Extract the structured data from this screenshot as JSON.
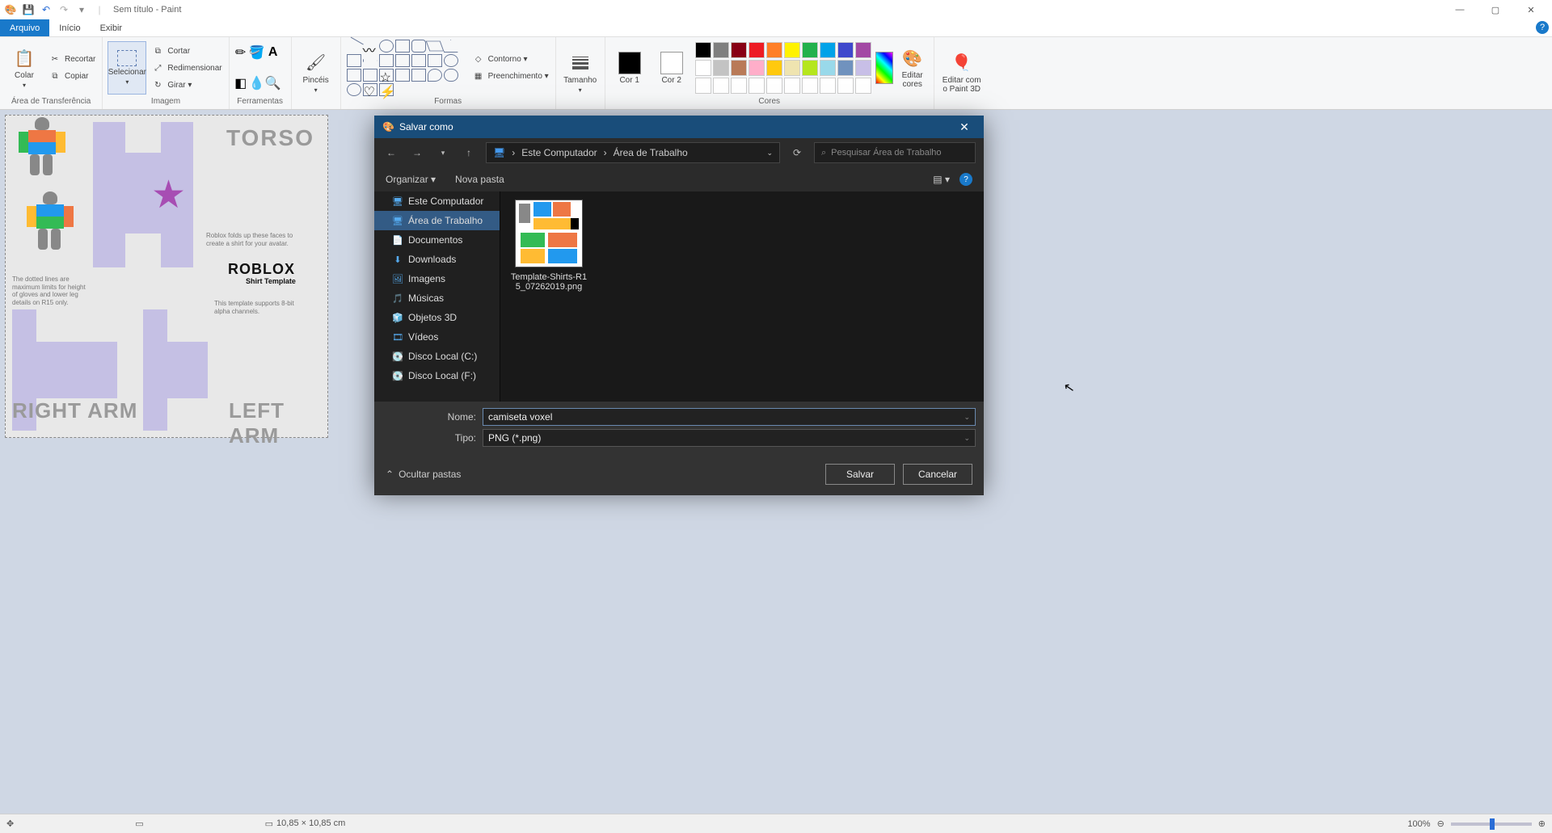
{
  "title": "Sem título - Paint",
  "tabs": {
    "file": "Arquivo",
    "home": "Início",
    "view": "Exibir"
  },
  "ribbon": {
    "clipboard": {
      "paste": "Colar",
      "cut": "Recortar",
      "copy": "Copiar",
      "label": "Área de Transferência"
    },
    "image": {
      "select": "Selecionar",
      "crop": "Cortar",
      "resize": "Redimensionar",
      "rotate": "Girar ▾",
      "label": "Imagem"
    },
    "tools": {
      "label": "Ferramentas"
    },
    "brushes": {
      "brushes": "Pincéis",
      "label": ""
    },
    "shapes": {
      "outline": "Contorno ▾",
      "fill": "Preenchimento ▾",
      "label": "Formas"
    },
    "size": {
      "label": "Tamanho"
    },
    "colors": {
      "c1": "Cor 1",
      "c2": "Cor 2",
      "edit": "Editar cores",
      "label": "Cores",
      "c1v": "#000000",
      "c2v": "#ffffff",
      "palette": [
        "#000000",
        "#7f7f7f",
        "#880015",
        "#ed1c24",
        "#ff7f27",
        "#fff200",
        "#22b14c",
        "#00a2e8",
        "#3f48cc",
        "#a349a4",
        "#ffffff",
        "#c3c3c3",
        "#b97a57",
        "#ffaec9",
        "#ffc90e",
        "#efe4b0",
        "#b5e61d",
        "#99d9ea",
        "#7092be",
        "#c8bfe7",
        "#ffffff",
        "#ffffff",
        "#ffffff",
        "#ffffff",
        "#ffffff",
        "#ffffff",
        "#ffffff",
        "#ffffff",
        "#ffffff",
        "#ffffff"
      ]
    },
    "paint3d": {
      "label": "Editar com o Paint 3D"
    }
  },
  "canvas": {
    "torso": "TORSO",
    "right_arm": "RIGHT ARM",
    "left_arm": "LEFT ARM",
    "roblox": "ROBLOX",
    "roblox_sub": "Shirt Template",
    "note1": "Roblox folds up these faces to create a shirt for your avatar.",
    "note2": "The dotted lines are maximum limits for height of gloves and lower leg details on R15 only.",
    "note3": "This template supports 8-bit alpha channels."
  },
  "status": {
    "dims": "10,85 × 10,85 cm",
    "zoom": "100%"
  },
  "dialog": {
    "title": "Salvar como",
    "breadcrumb": [
      "Este Computador",
      "Área de Trabalho"
    ],
    "search_placeholder": "Pesquisar Área de Trabalho",
    "organize": "Organizar ▾",
    "newfolder": "Nova pasta",
    "tree": [
      "Este Computador",
      "Área de Trabalho",
      "Documentos",
      "Downloads",
      "Imagens",
      "Músicas",
      "Objetos 3D",
      "Vídeos",
      "Disco Local (C:)",
      "Disco Local (F:)"
    ],
    "tree_selected": 1,
    "file": {
      "name": "Template-Shirts-R15_07262019.png"
    },
    "name_label": "Nome:",
    "name_value": "camiseta voxel",
    "type_label": "Tipo:",
    "type_value": "PNG (*.png)",
    "hide": "Ocultar pastas",
    "save": "Salvar",
    "cancel": "Cancelar"
  }
}
